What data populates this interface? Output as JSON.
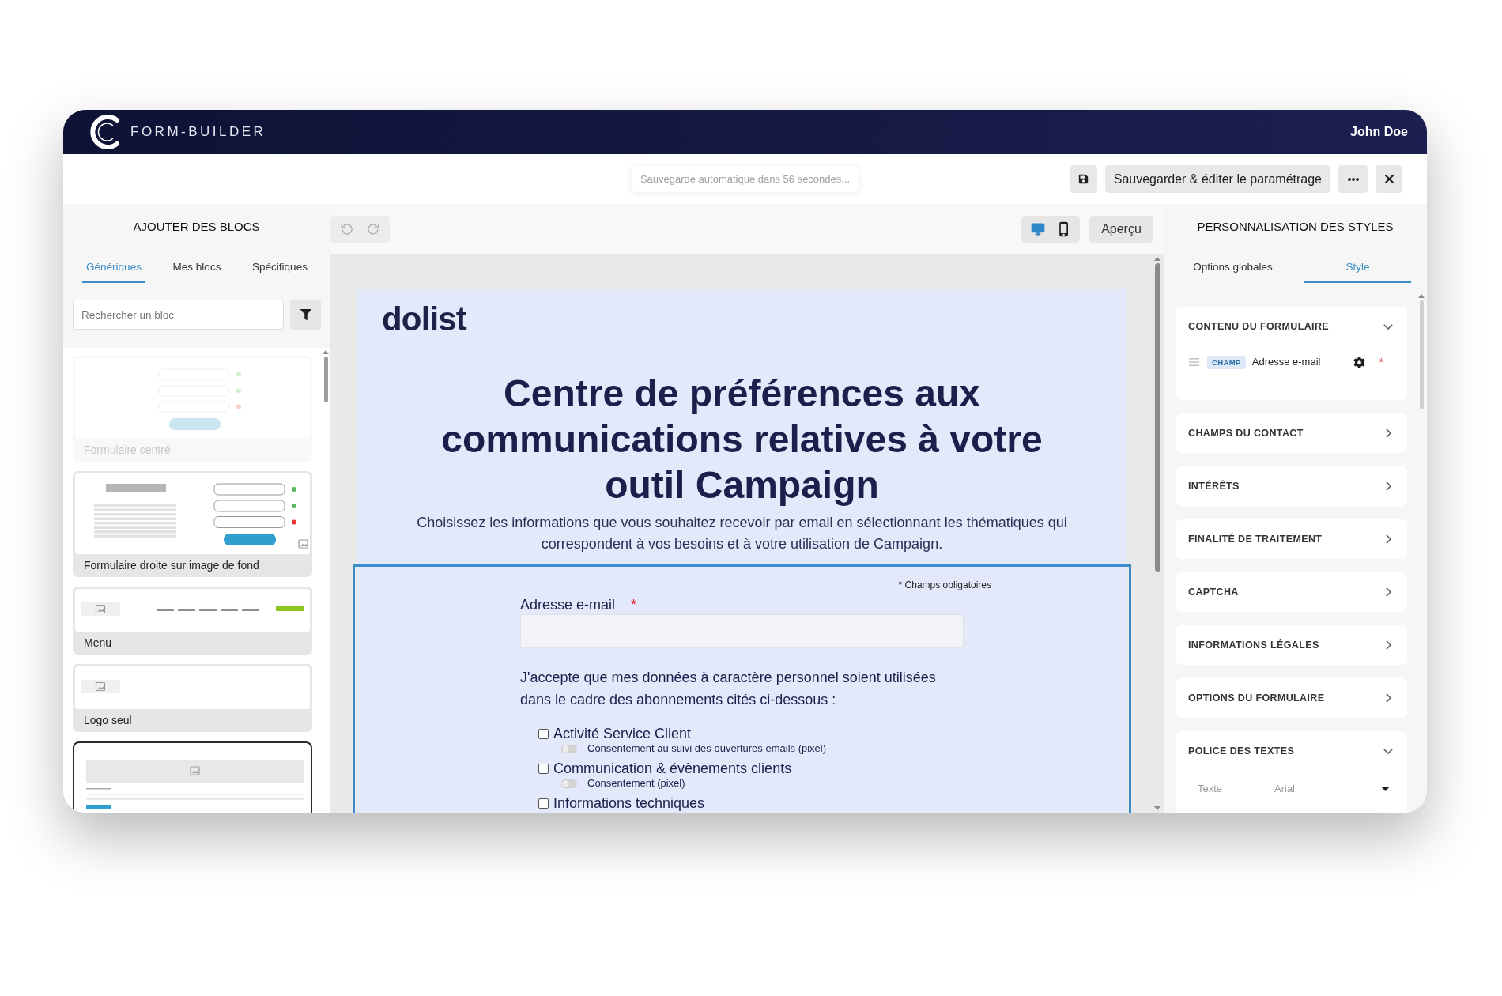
{
  "header": {
    "app_name": "FORM-BUILDER",
    "user": "John Doe"
  },
  "toolbar": {
    "autosave": "Sauvegarde automatique dans 56 secondes...",
    "save_edit_button": "Sauvegarder & éditer le paramétrage"
  },
  "blocks_panel": {
    "title": "AJOUTER DES BLOCS",
    "tabs": [
      {
        "label": "Génériques",
        "selected": true
      },
      {
        "label": "Mes blocs",
        "selected": false
      },
      {
        "label": "Spécifiques",
        "selected": false
      }
    ],
    "search": {
      "placeholder": "Rechercher un bloc"
    },
    "blocks": [
      {
        "kind": "centered-form",
        "label": "Formulaire centré",
        "disabled": true,
        "selected": false
      },
      {
        "kind": "background-form",
        "label": "Formulaire droite sur image de fond",
        "disabled": false,
        "selected": false
      },
      {
        "kind": "menu",
        "label": "Menu",
        "disabled": false,
        "selected": false
      },
      {
        "kind": "logo",
        "label": "Logo seul",
        "disabled": false,
        "selected": false
      },
      {
        "kind": "banner",
        "disabled": false,
        "selected": true
      }
    ]
  },
  "canvas": {
    "undo": {
      "disabled": true
    },
    "redo": {
      "disabled": true
    },
    "view_modes": [
      {
        "kind": "desktop",
        "selected": true
      },
      {
        "kind": "mobile",
        "selected": false
      }
    ],
    "preview_button": "Aperçu",
    "form": {
      "logo": "dolist",
      "title": "Centre de préférences aux communications relatives à votre outil Campaign",
      "intro": "Choisissez les informations que vous souhaitez recevoir par email en sélectionnant les thématiques qui correspondent à vos besoins et à votre utilisation de Campaign.",
      "fields_block": {
        "selected": true,
        "required_note": "* Champs obligatoires",
        "email_label": "Adresse e-mail",
        "required_mark": "*",
        "consent_text": "J'accepte que mes données à caractère personnel soient utilisées dans le cadre des abonnements cités ci-dessous :",
        "subscriptions": [
          {
            "label": "Activité Service Client",
            "checked": false,
            "tracking": {
              "label": "Consentement au suivi des ouvertures emails (pixel)",
              "on": false
            }
          },
          {
            "label": "Communication & évènements clients",
            "checked": false,
            "tracking": {
              "label": "Consentement (pixel)",
              "on": false
            }
          },
          {
            "label": "Informations techniques",
            "checked": false
          }
        ]
      }
    }
  },
  "styles_panel": {
    "title": "PERSONNALISATION DES STYLES",
    "tabs": [
      {
        "label": "Options globales",
        "selected": false
      },
      {
        "label": "Style",
        "selected": true
      }
    ],
    "sections": [
      {
        "title": "CONTENU DU FORMULAIRE",
        "expanded": true,
        "fields": [
          {
            "badge": "CHAMP",
            "label": "Adresse e-mail",
            "required_mark": "*"
          }
        ]
      },
      {
        "title": "CHAMPS DU CONTACT",
        "expanded": false
      },
      {
        "title": "INTÉRÊTS",
        "expanded": false
      },
      {
        "title": "FINALITÉ DE TRAITEMENT",
        "expanded": false
      },
      {
        "title": "CAPTCHA",
        "expanded": false
      },
      {
        "title": "INFORMATIONS LÉGALES",
        "expanded": false
      },
      {
        "title": "OPTIONS DU FORMULAIRE",
        "expanded": false
      },
      {
        "title": "POLICE DES TEXTES",
        "expanded": true,
        "settings": [
          {
            "label": "Texte",
            "value": "Arial"
          }
        ]
      }
    ]
  }
}
